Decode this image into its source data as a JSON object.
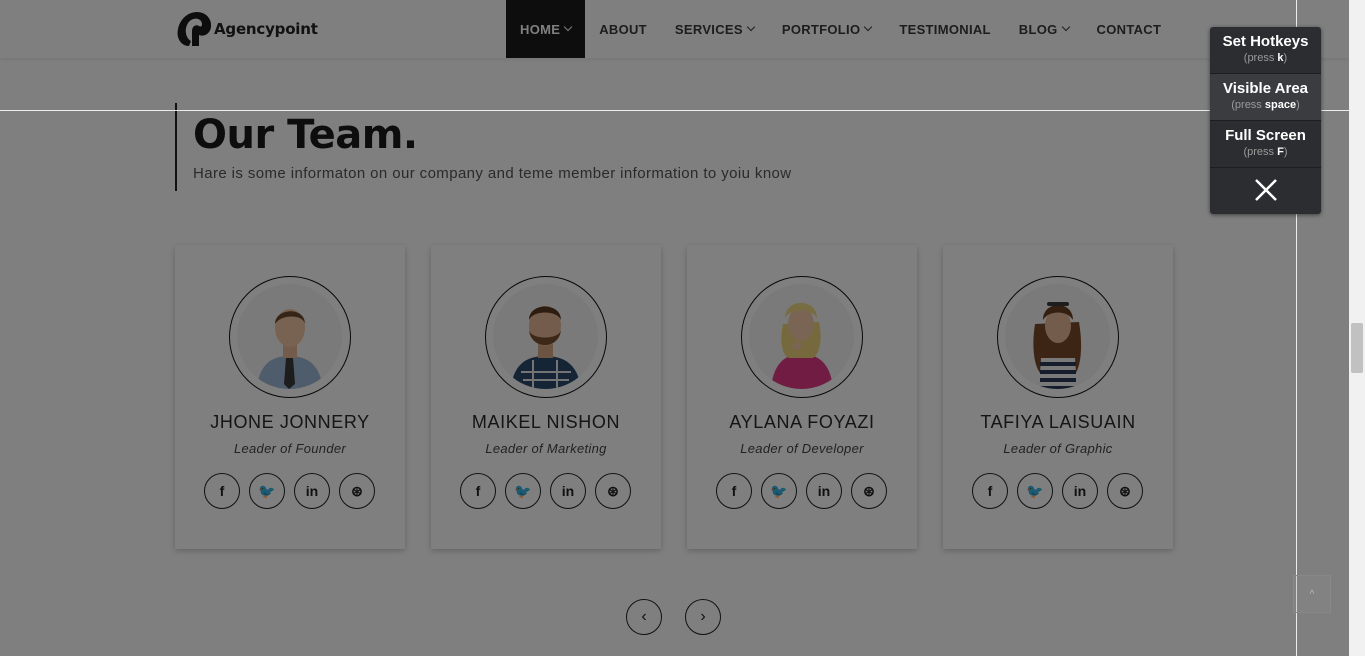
{
  "header": {
    "logo_text": "Agencypoint",
    "nav": [
      {
        "label": "HOME",
        "dropdown": true,
        "active": true
      },
      {
        "label": "ABOUT",
        "dropdown": false,
        "active": false
      },
      {
        "label": "SERVICES",
        "dropdown": true,
        "active": false
      },
      {
        "label": "PORTFOLIO",
        "dropdown": true,
        "active": false
      },
      {
        "label": "TESTIMONIAL",
        "dropdown": false,
        "active": false
      },
      {
        "label": "BLOG",
        "dropdown": true,
        "active": false
      },
      {
        "label": "CONTACT",
        "dropdown": false,
        "active": false
      }
    ]
  },
  "team": {
    "title": "Our Team.",
    "subtitle": "Hare is some informaton on our company and teme member information to yoiu know",
    "members": [
      {
        "name": "JHONE JONNERY",
        "role": "Leader of Founder",
        "avatar": "man-tie-icon"
      },
      {
        "name": "MAIKEL NISHON",
        "role": "Leader of Marketing",
        "avatar": "man-beard-icon"
      },
      {
        "name": "AYLANA FOYAZI",
        "role": "Leader of Developer",
        "avatar": "woman-blonde-icon"
      },
      {
        "name": "TAFIYA LAISUAIN",
        "role": "Leader of Graphic",
        "avatar": "woman-brunette-icon"
      }
    ],
    "socials": [
      {
        "icon": "facebook-icon",
        "glyph": "f"
      },
      {
        "icon": "twitter-icon",
        "glyph": "🐦"
      },
      {
        "icon": "linkedin-icon",
        "glyph": "in"
      },
      {
        "icon": "dribbble-icon",
        "glyph": "⊛"
      }
    ],
    "prev_glyph": "‹",
    "next_glyph": "›"
  },
  "hotkeys_panel": {
    "items": [
      {
        "label": "Set Hotkeys",
        "hint_prefix": "(press ",
        "key": "k",
        "hint_suffix": ")"
      },
      {
        "label": "Visible Area",
        "hint_prefix": "(press ",
        "key": "space",
        "hint_suffix": ")"
      },
      {
        "label": "Full Screen",
        "hint_prefix": "(press ",
        "key": "F",
        "hint_suffix": ")"
      }
    ]
  },
  "scroll_top_glyph": "^",
  "colors": {
    "nav_active_bg": "#1a1a1a",
    "overlay": "rgba(0,0,0,0.5)",
    "panel_bg": "#2b2d30"
  }
}
